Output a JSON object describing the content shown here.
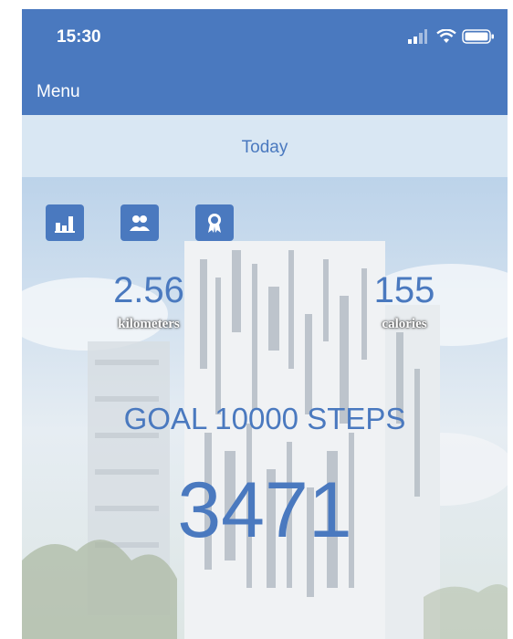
{
  "status_bar": {
    "time": "15:30",
    "icons": [
      "signal-icon",
      "wifi-icon",
      "battery-icon"
    ]
  },
  "header": {
    "menu_label": "Menu"
  },
  "day_bar": {
    "label": "Today"
  },
  "toolbar": {
    "icons": [
      "bar-chart-icon",
      "people-icon",
      "award-icon"
    ]
  },
  "metrics": {
    "distance": {
      "value": "2.56",
      "unit": "kilometers"
    },
    "calories": {
      "value": "155",
      "unit": "calories"
    }
  },
  "goal": {
    "label": "GOAL 10000 STEPS"
  },
  "steps": {
    "count": "3471"
  },
  "colors": {
    "primary": "#4a79bf",
    "today_bar": "#d9e7f3",
    "text_white": "#ffffff"
  }
}
